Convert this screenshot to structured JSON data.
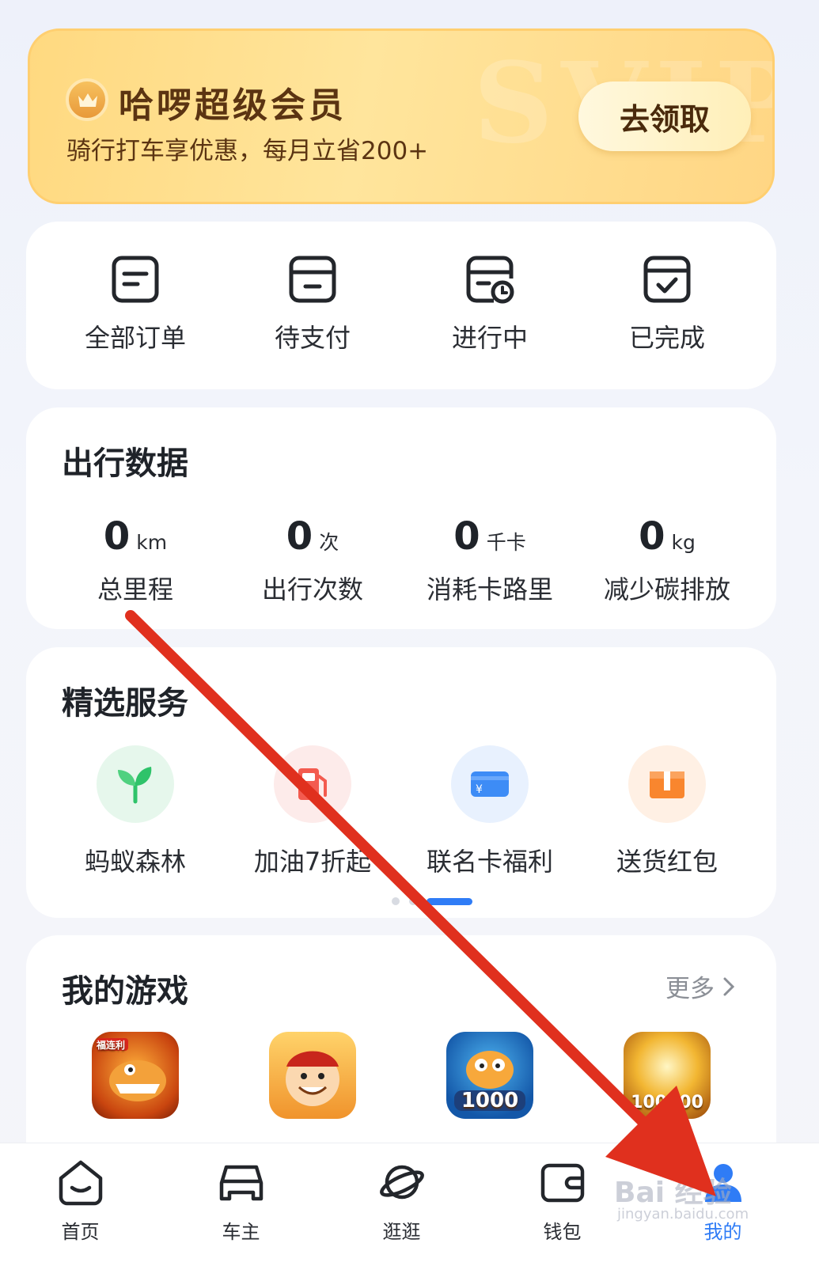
{
  "vip": {
    "title": "哈啰超级会员",
    "subtitle": "骑行打车享优惠，每月立省200+",
    "button": "去领取",
    "watermark": "SVIP"
  },
  "orders": {
    "items": [
      {
        "label": "全部订单",
        "icon": "all-orders-icon"
      },
      {
        "label": "待支付",
        "icon": "pending-payment-icon"
      },
      {
        "label": "进行中",
        "icon": "in-progress-icon"
      },
      {
        "label": "已完成",
        "icon": "completed-icon"
      }
    ]
  },
  "travel": {
    "title": "出行数据",
    "stats": [
      {
        "value": "0",
        "unit": "km",
        "label": "总里程"
      },
      {
        "value": "0",
        "unit": "次",
        "label": "出行次数"
      },
      {
        "value": "0",
        "unit": "千卡",
        "label": "消耗卡路里"
      },
      {
        "value": "0",
        "unit": "kg",
        "label": "减少碳排放"
      }
    ]
  },
  "services": {
    "title": "精选服务",
    "items": [
      {
        "label": "蚂蚁森林",
        "icon": "sprout-icon",
        "color": "#2fc36a"
      },
      {
        "label": "加油7折起",
        "icon": "fuel-pump-icon",
        "color": "#f35b4f"
      },
      {
        "label": "联名卡福利",
        "icon": "bank-card-icon",
        "color": "#3d8cf6"
      },
      {
        "label": "送货红包",
        "icon": "parcel-icon",
        "color": "#f9862e"
      }
    ]
  },
  "games": {
    "title": "我的游戏",
    "more": "更多",
    "items": [
      {
        "badge": "福连利",
        "icon": "fishing-game-icon"
      },
      {
        "badge": "",
        "icon": "card-game-icon"
      },
      {
        "badge": "1000",
        "icon": "fish-game-icon"
      },
      {
        "badge": "100000",
        "icon": "gold-coin-game-icon"
      }
    ]
  },
  "tabbar": {
    "tabs": [
      {
        "label": "首页",
        "icon": "home-icon"
      },
      {
        "label": "车主",
        "icon": "car-icon"
      },
      {
        "label": "逛逛",
        "icon": "planet-icon"
      },
      {
        "label": "钱包",
        "icon": "wallet-icon"
      },
      {
        "label": "我的",
        "icon": "profile-icon",
        "active": true
      }
    ]
  },
  "watermark": {
    "brand": "Bai 经验",
    "url": "jingyan.baidu.com"
  },
  "colors": {
    "accent": "#2f7cf6",
    "annotation_arrow": "#e0301e",
    "vip_gold": "#ffd980"
  }
}
